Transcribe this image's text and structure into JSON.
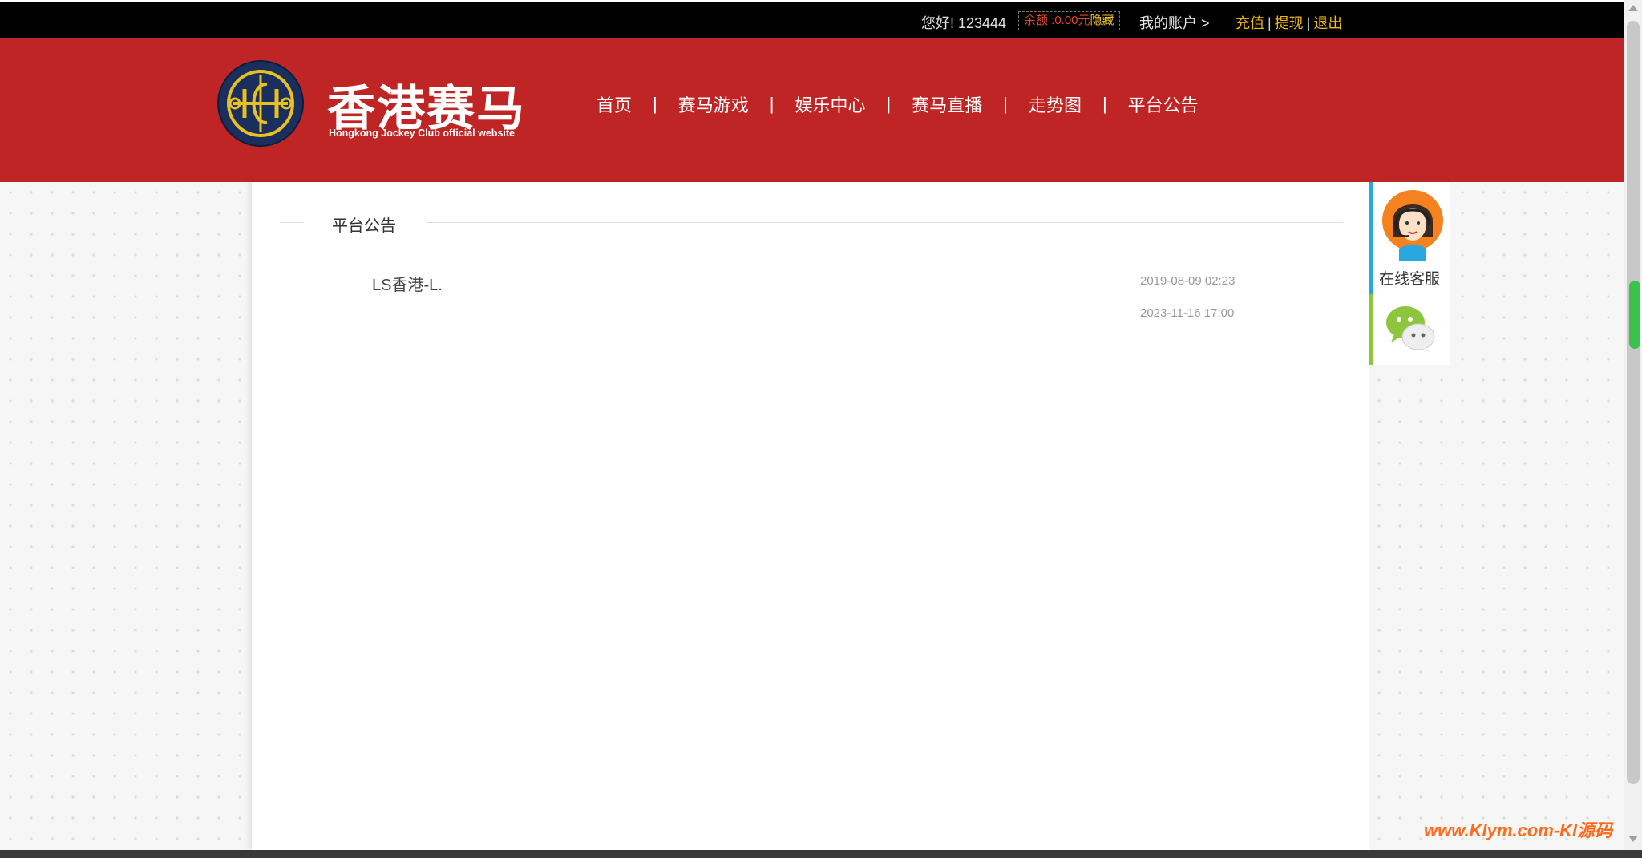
{
  "topbar": {
    "greeting": "您好! 123444",
    "balance_label": "余额 :0.00元",
    "hide_label": "隐藏",
    "account_label": "我的账户 >",
    "recharge": "充值",
    "withdraw": "提现",
    "logout": "退出",
    "sep": "|"
  },
  "header": {
    "logo_title": "香港赛马",
    "logo_subtitle": "Hongkong Jockey Club official website",
    "nav": {
      "home": "首页",
      "horse_game": "赛马游戏",
      "entertainment": "娱乐中心",
      "live": "赛马直播",
      "trend": "走势图",
      "announcement": "平台公告",
      "sep": "|"
    }
  },
  "main": {
    "section_title": "平台公告",
    "notices": [
      {
        "title": "LS香港-L.",
        "date": "2019-08-09 02:23"
      },
      {
        "title": "",
        "date": "2023-11-16 17:00"
      }
    ]
  },
  "side": {
    "customer_service_label": "在线客服"
  },
  "watermark": "www.Klym.com-Kl源码",
  "colors": {
    "header_red": "#c02526",
    "topbar_black": "#000000",
    "link_gold": "#f0b90b",
    "cs_blue": "#29a8e0",
    "wechat_green": "#8cc63f"
  },
  "icons": {
    "logo": "hkjc-emblem-icon",
    "customer_service": "customer-service-avatar-icon",
    "wechat": "wechat-icon"
  }
}
